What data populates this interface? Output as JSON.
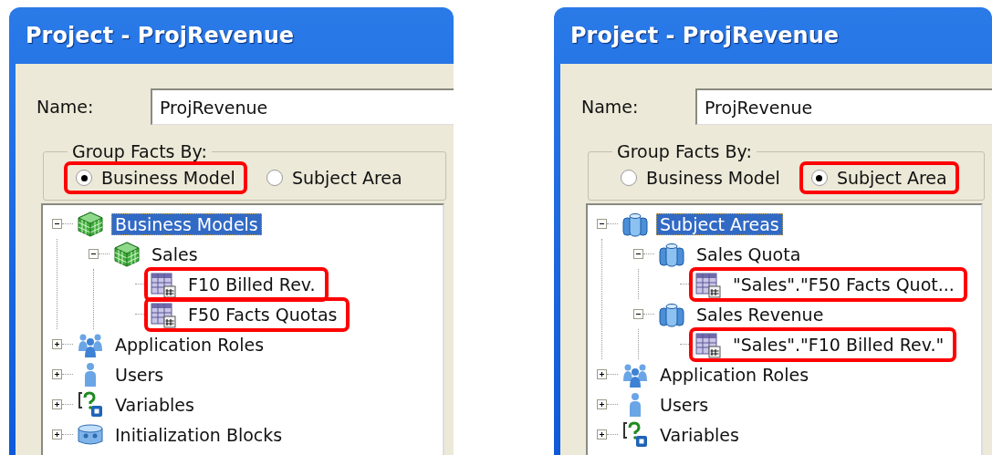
{
  "windows": [
    {
      "title": "Project - ProjRevenue",
      "name_label": "Name:",
      "name_value": "ProjRevenue",
      "group_label": "Group Facts By:",
      "options": [
        {
          "label": "Business Model",
          "selected": true,
          "highlighted": true
        },
        {
          "label": "Subject Area",
          "selected": false,
          "highlighted": false
        }
      ],
      "tree": [
        {
          "label": "Business Models",
          "kind": "business_model",
          "expanded": true,
          "selected": true,
          "highlighted": false,
          "children": [
            {
              "label": "Sales",
              "kind": "business_model",
              "expanded": true,
              "selected": false,
              "highlighted": false,
              "children": [
                {
                  "label": "F10 Billed Rev.",
                  "kind": "fact_table",
                  "selected": false,
                  "highlighted": true
                },
                {
                  "label": "F50 Facts Quotas",
                  "kind": "fact_table",
                  "selected": false,
                  "highlighted": true
                }
              ]
            }
          ]
        },
        {
          "label": "Application Roles",
          "kind": "roles",
          "expanded": false,
          "selected": false,
          "highlighted": false
        },
        {
          "label": "Users",
          "kind": "user",
          "expanded": false,
          "selected": false,
          "highlighted": false
        },
        {
          "label": "Variables",
          "kind": "variable",
          "expanded": false,
          "selected": false,
          "highlighted": false
        },
        {
          "label": "Initialization Blocks",
          "kind": "init_block",
          "expanded": false,
          "selected": false,
          "highlighted": false
        }
      ]
    },
    {
      "title": "Project - ProjRevenue",
      "name_label": "Name:",
      "name_value": "ProjRevenue",
      "group_label": "Group Facts By:",
      "options": [
        {
          "label": "Business Model",
          "selected": false,
          "highlighted": false
        },
        {
          "label": "Subject Area",
          "selected": true,
          "highlighted": true
        }
      ],
      "tree": [
        {
          "label": "Subject Areas",
          "kind": "subject_area",
          "expanded": true,
          "selected": true,
          "highlighted": false,
          "children": [
            {
              "label": "Sales Quota",
              "kind": "subject_area",
              "expanded": true,
              "selected": false,
              "highlighted": false,
              "children": [
                {
                  "label": "\"Sales\".\"F50 Facts Quot...",
                  "kind": "fact_table",
                  "selected": false,
                  "highlighted": true
                }
              ]
            },
            {
              "label": "Sales Revenue",
              "kind": "subject_area",
              "expanded": true,
              "selected": false,
              "highlighted": false,
              "children": [
                {
                  "label": "\"Sales\".\"F10 Billed Rev.\"",
                  "kind": "fact_table",
                  "selected": false,
                  "highlighted": true
                }
              ]
            }
          ]
        },
        {
          "label": "Application Roles",
          "kind": "roles",
          "expanded": false,
          "selected": false,
          "highlighted": false
        },
        {
          "label": "Users",
          "kind": "user",
          "expanded": false,
          "selected": false,
          "highlighted": false
        },
        {
          "label": "Variables",
          "kind": "variable",
          "expanded": false,
          "selected": false,
          "highlighted": false
        }
      ]
    }
  ]
}
